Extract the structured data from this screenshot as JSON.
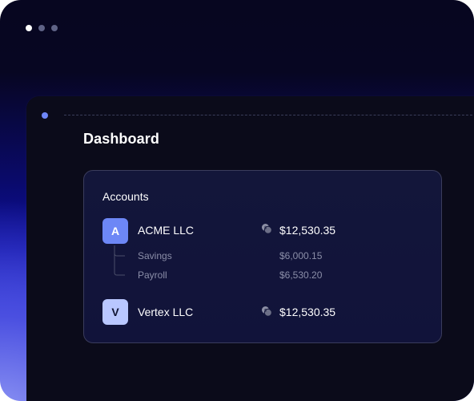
{
  "window_controls": {
    "dots": [
      "active",
      "inactive",
      "inactive"
    ]
  },
  "page": {
    "title": "Dashboard"
  },
  "accounts_card": {
    "title": "Accounts",
    "accounts": [
      {
        "initial": "A",
        "name": "ACME LLC",
        "icon": "coins-icon",
        "balance": "$12,530.35",
        "sub_accounts": [
          {
            "name": "Savings",
            "balance": "$6,000.15"
          },
          {
            "name": "Payroll",
            "balance": "$6,530.20"
          }
        ]
      },
      {
        "initial": "V",
        "name": "Vertex LLC",
        "icon": "coins-icon",
        "balance": "$12,530.35",
        "sub_accounts": []
      }
    ]
  },
  "colors": {
    "accent": "#6d87f6",
    "accent_light": "#b9c7ff",
    "window_bg": "#0b0b1a",
    "card_bg": "#13163a"
  }
}
